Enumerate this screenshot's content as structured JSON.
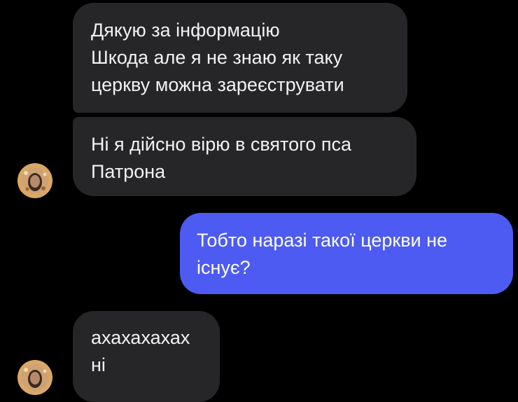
{
  "conversation": {
    "messages": [
      {
        "sender": "other",
        "text": "Дякую за інформацію\nШкода але я не знаю як таку\nцеркву можна зареєструвати"
      },
      {
        "sender": "other",
        "text": "Ні я дійсно вірю в святого пса\nПатрона"
      },
      {
        "sender": "me",
        "text": "Тобто наразі такої церкви не\nіснує?"
      },
      {
        "sender": "other",
        "text": "ахахахахах\nні"
      }
    ]
  },
  "colors": {
    "background": "#000000",
    "incoming_bubble": "#262628",
    "outgoing_bubble": "#4d5bf2",
    "text": "#f2f2f2"
  },
  "icons": {
    "avatar": "contact-avatar-icon"
  }
}
